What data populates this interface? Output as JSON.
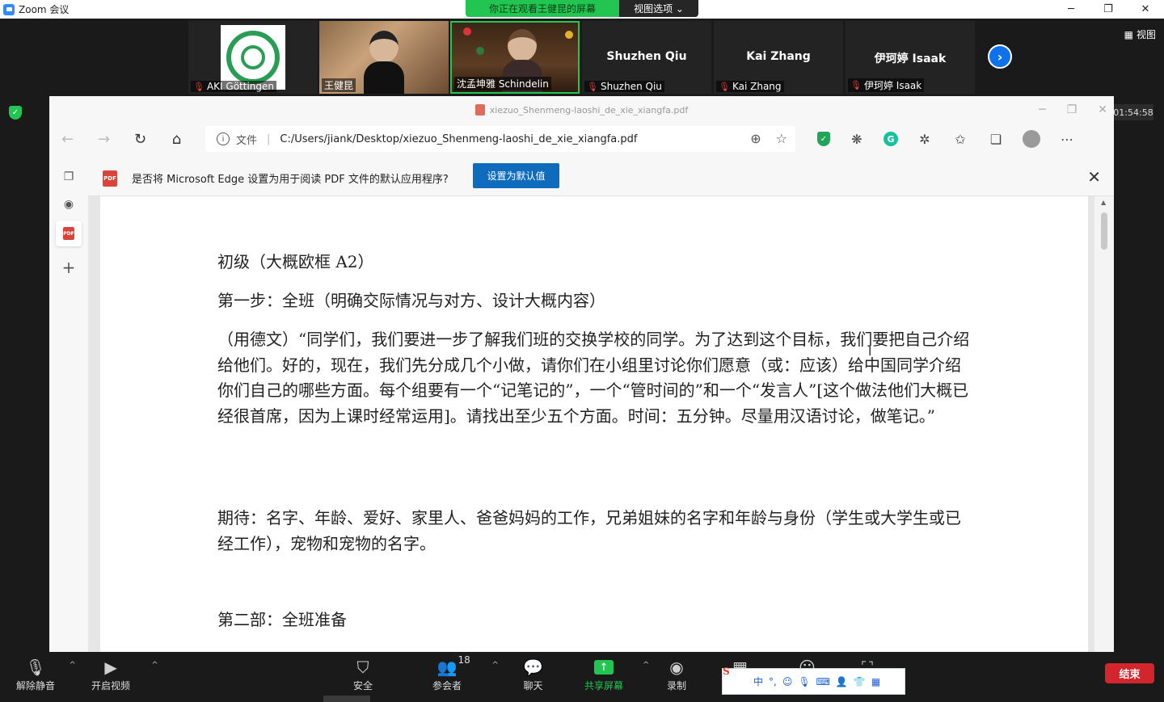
{
  "zoom": {
    "window_title": "Zoom 会议",
    "share_banner": "你正在观看王健昆的屏幕",
    "view_options": "视图选项 ⌄",
    "view_label": "视图",
    "timer": "01:54:58",
    "participants": [
      {
        "name": "AKI Göttingen",
        "muted": true
      },
      {
        "name": "王健昆",
        "muted": false
      },
      {
        "name": "沈孟坤雅 Schindelin",
        "muted": false
      },
      {
        "display": "Shuzhen Qiu",
        "name": "Shuzhen Qiu",
        "muted": true
      },
      {
        "display": "Kai Zhang",
        "name": "Kai Zhang",
        "muted": true
      },
      {
        "display": "伊珂婷 Isaak",
        "name": "伊珂婷 Isaak",
        "muted": true
      }
    ],
    "toolbar": {
      "unmute": "解除静音",
      "start_video": "开启视频",
      "security": "安全",
      "participants": "参会者",
      "participant_count": "18",
      "chat": "聊天",
      "share_screen": "共享屏幕",
      "record": "录制",
      "end": "结束"
    },
    "colors": {
      "share_green": "#23c552",
      "end_red": "#d3262c",
      "blue": "#0e72ed"
    }
  },
  "edge": {
    "tab_title": "xiezuo_Shenmeng-laoshi_de_xie_xiangfa.pdf",
    "address_label": "文件",
    "address_path": "C:/Users/jiank/Desktop/xiezuo_Shenmeng-laoshi_de_xie_xiangfa.pdf",
    "notify_message": "是否将 Microsoft Edge 设置为用于阅读 PDF 文件的默认应用程序?",
    "notify_button": "设置为默认值"
  },
  "pdf": {
    "p1": "初级（大概欧框 A2）",
    "p2": "第一步：全班（明确交际情况与对方、设计大概内容）",
    "p3": "（用德文）“同学们，我们要进一步了解我们班的交换学校的同学。为了达到这个目标，我们要把自己介绍给他们。好的，现在，我们先分成几个小做，请你们在小组里讨论你们愿意（或：应该）给中国同学介绍你们自己的哪些方面。每个组要有一个“记笔记的”，一个“管时间的”和一个“发言人”[这个做法他们大概已经很首席，因为上课时经常运用]。请找出至少五个方面。时间：五分钟。尽量用汉语讨论，做笔记。”",
    "p4": "期待：名字、年龄、爱好、家里人、爸爸妈妈的工作，兄弟姐妹的名字和年龄与身份（学生或大学生或已经工作），宠物和宠物的名字。",
    "p5": "第二部：全班准备"
  },
  "ime": {
    "lang": "中"
  }
}
